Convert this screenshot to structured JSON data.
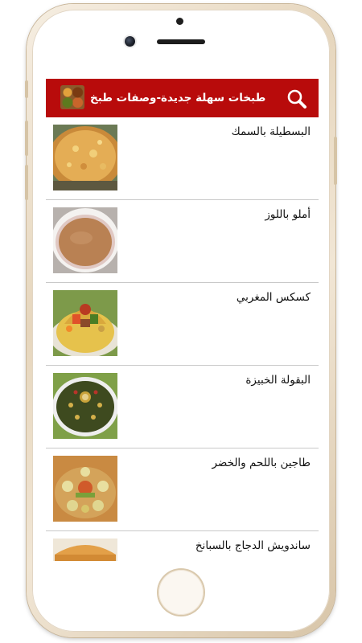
{
  "app": {
    "title": "طبخات سهلة جديدة-وصفات طبخ",
    "brand_color": "#b80b0b"
  },
  "icons": {
    "search": "search-icon",
    "logo": "app-logo-icon"
  },
  "recipes": [
    {
      "title": "البسطيلة بالسمك",
      "image": "pastilla-image"
    },
    {
      "title": "أملو باللوز",
      "image": "amlou-image"
    },
    {
      "title": "كسكس المغربي",
      "image": "couscous-image"
    },
    {
      "title": "البقولة الخبيزة",
      "image": "bakoula-image"
    },
    {
      "title": "طاجين باللحم والخضر",
      "image": "tajine-image"
    },
    {
      "title": "ساندويش الدجاج بالسبانخ",
      "image": "sandwich-image"
    }
  ]
}
